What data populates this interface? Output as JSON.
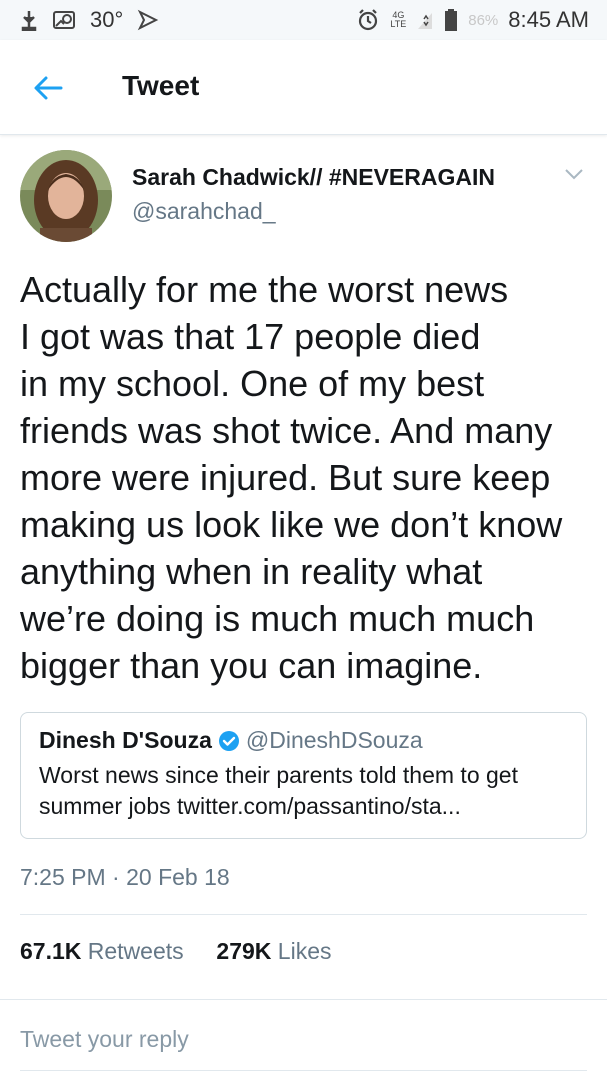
{
  "status_bar": {
    "temperature": "30°",
    "network": "4G",
    "network_sub": "LTE",
    "battery": "86%",
    "time": "8:45 AM"
  },
  "header": {
    "title": "Tweet",
    "back_icon": "arrow-left-icon"
  },
  "tweet": {
    "author_name": "Sarah Chadwick// #NEVERAGAIN",
    "author_handle": "@sarahchad_",
    "text_lines": [
      "Actually for me the worst news",
      "I got was that 17 people died",
      "in my school. One of my best",
      "friends was shot twice. And many",
      "more were injured. But sure keep",
      "making us look like we don’t know",
      "anything when in reality what",
      "we’re doing is much much much",
      "bigger than you can imagine."
    ],
    "quoted": {
      "name": "Dinesh D'Souza",
      "handle": "@DineshDSouza",
      "text_lines": [
        "Worst news since their parents told them to get",
        "summer jobs twitter.com/passantino/sta..."
      ]
    },
    "timestamp": "7:25 PM · 20 Feb 18",
    "retweets_count": "67.1K",
    "retweets_label": "Retweets",
    "likes_count": "279K",
    "likes_label": "Likes"
  },
  "reply": {
    "placeholder": "Tweet your reply"
  },
  "colors": {
    "accent": "#1da1f2",
    "secondary_text": "#657786",
    "divider": "#e1e8ed"
  }
}
